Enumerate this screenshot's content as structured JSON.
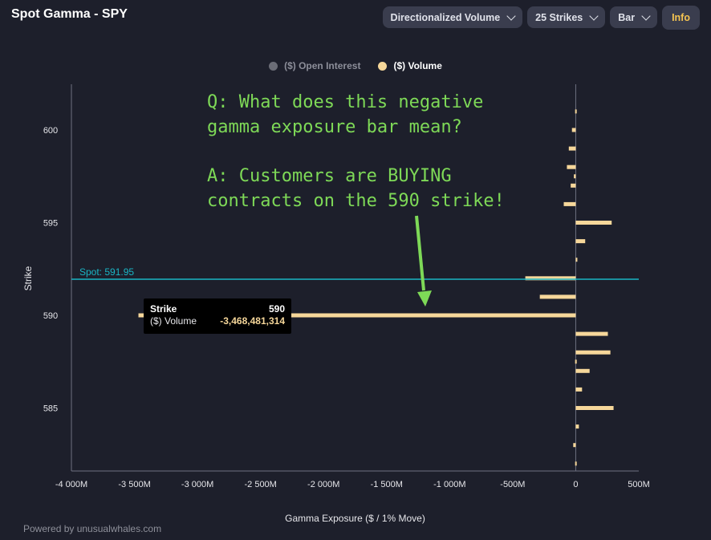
{
  "header": {
    "title": "Spot Gamma - SPY",
    "controls": {
      "mode": "Directionalized Volume",
      "strikes": "25 Strikes",
      "chart_type": "Bar",
      "info": "Info"
    }
  },
  "legend": {
    "open_interest": "($) Open Interest",
    "volume": "($) Volume"
  },
  "annotation": {
    "lines": [
      "Q: What does this negative",
      "gamma exposure bar mean?",
      "A: Customers are BUYING",
      "contracts on the 590 strike!"
    ],
    "color": "#7ed957"
  },
  "spot_label": "Spot: 591.95",
  "tooltip": {
    "strike_label": "Strike",
    "strike_value": "590",
    "volume_label": "($) Volume",
    "volume_value": "-3,468,481,314"
  },
  "footer": "Powered by unusualwhales.com",
  "chart_data": {
    "type": "bar",
    "orientation": "horizontal",
    "xlabel": "Gamma Exposure ($ / 1% Move)",
    "ylabel": "Strike",
    "xlim": [
      -4000,
      500
    ],
    "ylim": [
      582,
      602
    ],
    "x_ticks": [
      -4000,
      -3500,
      -3000,
      -2500,
      -2000,
      -1500,
      -1000,
      -500,
      0,
      500
    ],
    "x_tick_labels": [
      "-4 000M",
      "-3 500M",
      "-3 000M",
      "-2 500M",
      "-2 000M",
      "-1 500M",
      "-1 000M",
      "-500M",
      "0",
      "500M"
    ],
    "y_ticks": [
      585,
      590,
      595,
      600
    ],
    "y_tick_labels": [
      "585",
      "590",
      "595",
      "600"
    ],
    "spot": 591.95,
    "series": [
      {
        "name": "($) Volume",
        "color": "#f6d79a",
        "points": [
          {
            "strike": 601,
            "value": -5
          },
          {
            "strike": 600,
            "value": -30
          },
          {
            "strike": 599,
            "value": -55
          },
          {
            "strike": 598,
            "value": -70
          },
          {
            "strike": 597.5,
            "value": -15
          },
          {
            "strike": 597,
            "value": -40
          },
          {
            "strike": 596,
            "value": -95
          },
          {
            "strike": 595,
            "value": 285
          },
          {
            "strike": 594,
            "value": 75
          },
          {
            "strike": 593,
            "value": 10
          },
          {
            "strike": 592,
            "value": -400
          },
          {
            "strike": 591,
            "value": -285
          },
          {
            "strike": 590,
            "value": -3468.48
          },
          {
            "strike": 589,
            "value": 255
          },
          {
            "strike": 588,
            "value": 275
          },
          {
            "strike": 587.5,
            "value": -5
          },
          {
            "strike": 587,
            "value": 110
          },
          {
            "strike": 586,
            "value": 50
          },
          {
            "strike": 585,
            "value": 300
          },
          {
            "strike": 584,
            "value": 25
          },
          {
            "strike": 583,
            "value": -20
          },
          {
            "strike": 582,
            "value": -5
          }
        ]
      }
    ],
    "colors": {
      "bar": "#f6d79a",
      "spot_line": "#1ab5c4",
      "axis": "#6e7080"
    }
  }
}
